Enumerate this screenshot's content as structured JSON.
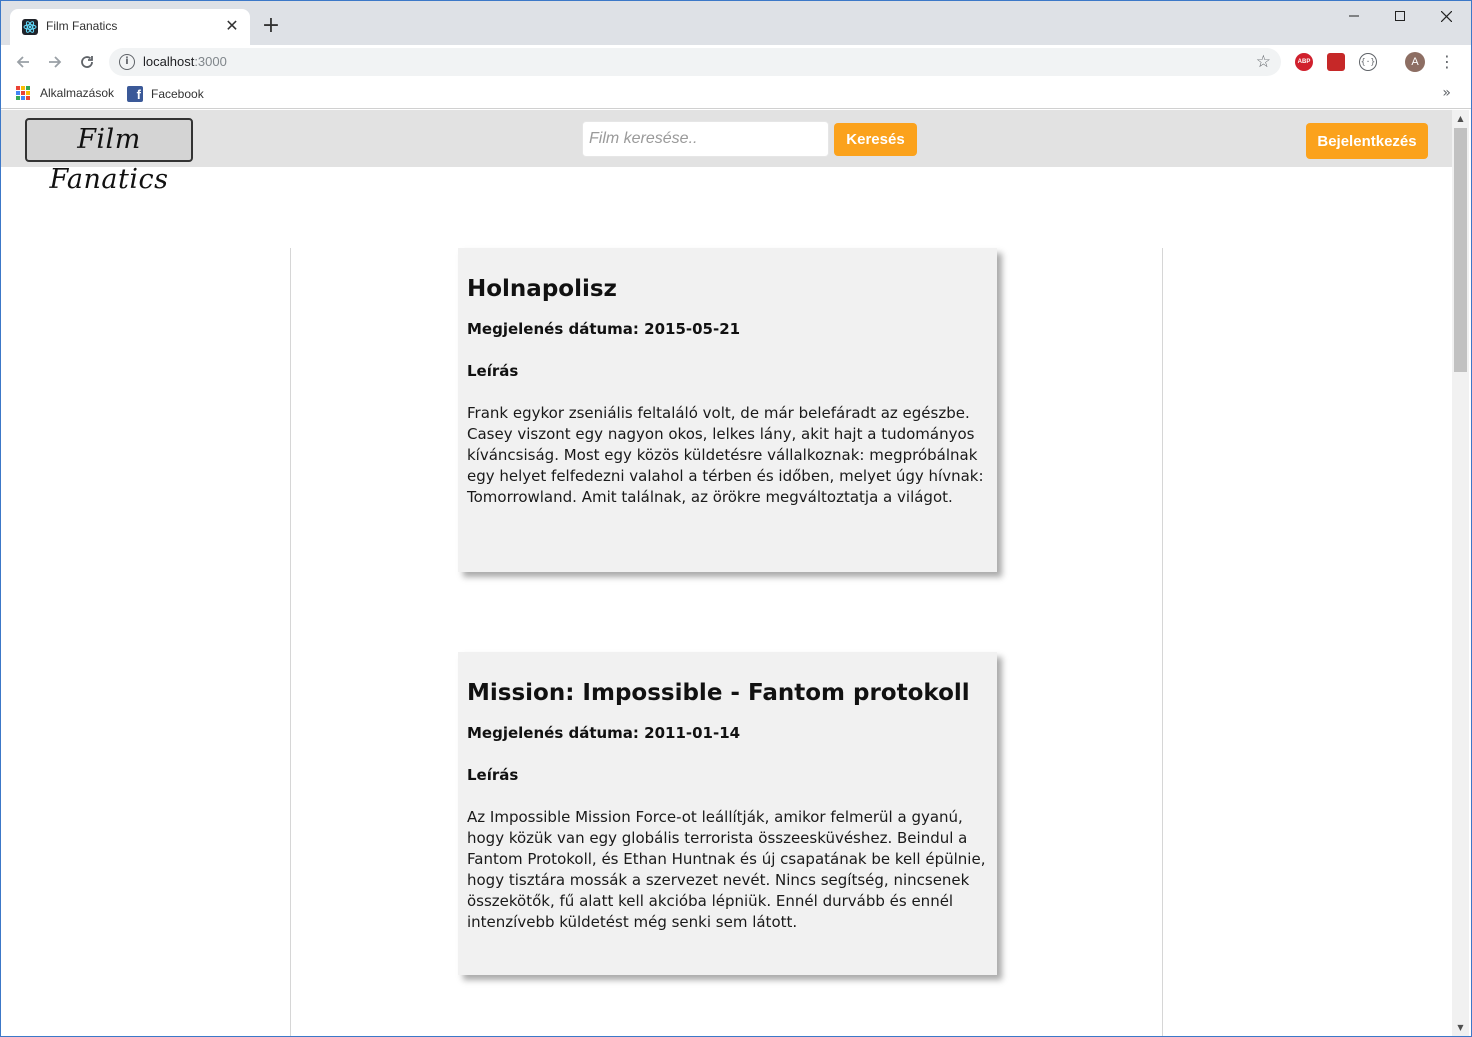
{
  "browser": {
    "tab_title": "Film Fanatics",
    "url_host": "localhost",
    "url_port": ":3000",
    "bookmarks": [
      {
        "label": "Alkalmazások"
      },
      {
        "label": "Facebook"
      }
    ],
    "avatar_letter": "A",
    "abp_label": "ABP"
  },
  "navbar": {
    "logo": "Film Fanatics",
    "search_placeholder": "Film keresése..",
    "search_button": "Keresés",
    "login_button": "Bejelentkezés"
  },
  "movies": [
    {
      "title": "Holnapolisz",
      "date": "Megjelenés dátuma: 2015-05-21",
      "desc_label": "Leírás",
      "description": "Frank egykor zseniális feltaláló volt, de már belefáradt az egészbe. Casey viszont egy nagyon okos, lelkes lány, akit hajt a tudományos kíváncsiság. Most egy közös küldetésre vállalkoznak: megpróbálnak egy helyet felfedezni valahol a térben és időben, melyet úgy hívnak: Tomorrowland. Amit találnak, az örökre megváltoztatja a világot."
    },
    {
      "title": "Mission: Impossible - Fantom protokoll",
      "date": "Megjelenés dátuma: 2011-01-14",
      "desc_label": "Leírás",
      "description": "Az Impossible Mission Force-ot leállítják, amikor felmerül a gyanú, hogy közük van egy globális terrorista összeesküvéshez. Beindul a Fantom Protokoll, és Ethan Huntnak és új csapatának be kell épülnie, hogy tisztára mossák a szervezet nevét. Nincs segítség, nincsenek összekötők, fű alatt kell akcióba lépniük. Ennél durvább és ennél intenzívebb küldetést még senki sem látott."
    }
  ],
  "colors": {
    "accent": "#fba21c",
    "navbar_bg": "#e2e2e2",
    "card_bg": "#f1f1f1"
  }
}
